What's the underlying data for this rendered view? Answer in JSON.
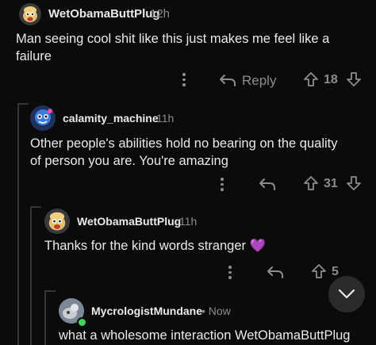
{
  "comments": [
    {
      "username": "WetObamaButtPlug",
      "time": "12h",
      "body": "Man seeing cool shit like this just makes me feel like a failure",
      "reply_label": "Reply",
      "score": "18"
    },
    {
      "username": "calamity_machine",
      "time": "11h",
      "body": "Other people's abilities hold no bearing on the quality of person you are. You're amazing",
      "score": "31"
    },
    {
      "username": "WetObamaButtPlug",
      "time": "11h",
      "body": "Thanks for the kind words stranger",
      "emoji": "💜",
      "score": "5"
    },
    {
      "username": "MycrologistMundane",
      "time": "• Now",
      "body": "what a wholesome interaction WetObamaButtPlug"
    }
  ],
  "colors": {
    "background": "#0b0b0b",
    "thread_line": "#343536",
    "muted": "#8a8d90",
    "online": "#46d160"
  }
}
